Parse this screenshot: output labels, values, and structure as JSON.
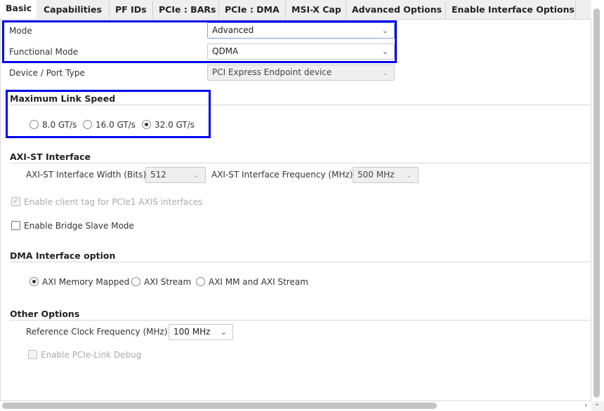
{
  "tabs": [
    "Basic",
    "Capabilities",
    "PF IDs",
    "PCIe : BARs",
    "PCIe : DMA",
    "MSI-X Cap",
    "Advanced Options",
    "Enable Interface Options"
  ],
  "basic": {
    "mode_label": "Mode",
    "mode_value": "Advanced",
    "functional_mode_label": "Functional Mode",
    "functional_mode_value": "QDMA",
    "device_port_label": "Device / Port Type",
    "device_port_value": "PCI Express Endpoint device"
  },
  "link_speed": {
    "title": "Maximum Link Speed",
    "options": [
      "8.0 GT/s",
      "16.0 GT/s",
      "32.0 GT/s"
    ],
    "selected": "32.0 GT/s"
  },
  "axi_st": {
    "title": "AXI-ST Interface",
    "width_label": "AXI-ST Interface Width (Bits)",
    "width_value": "512",
    "freq_label": "AXI-ST Interface Frequency (MHz)",
    "freq_value": "500 MHz",
    "client_tag_label": "Enable client tag for PCIe1 AXIS interfaces",
    "bridge_slave_label": "Enable Bridge Slave Mode"
  },
  "dma": {
    "title": "DMA Interface option",
    "options": [
      "AXI Memory Mapped",
      "AXI Stream",
      "AXI MM and AXI Stream"
    ],
    "selected": "AXI Memory Mapped"
  },
  "other": {
    "title": "Other Options",
    "ref_clock_label": "Reference Clock Frequency (MHz)",
    "ref_clock_value": "100 MHz",
    "link_debug_label": "Enable PCIe-Link Debug"
  },
  "colors": {
    "highlight": "#0000ee"
  }
}
